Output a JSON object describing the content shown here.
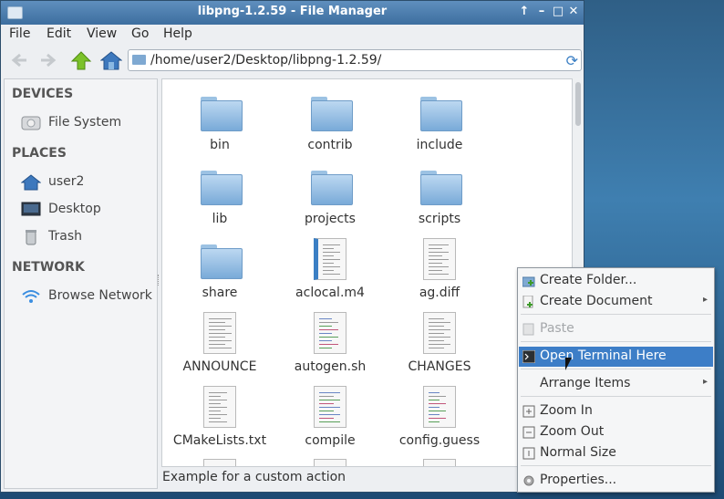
{
  "window": {
    "title": "libpng-1.2.59 - File Manager",
    "controls": {
      "up": "↑",
      "minimize": "–",
      "maximize": "□",
      "close": "✕"
    }
  },
  "menubar": {
    "items": [
      "File",
      "Edit",
      "View",
      "Go",
      "Help"
    ]
  },
  "toolbar": {
    "path": "/home/user2/Desktop/libpng-1.2.59/",
    "icons": [
      "back-arrow-icon",
      "forward-arrow-icon",
      "up-arrow-icon",
      "home-icon",
      "reload-icon"
    ]
  },
  "sidebar": {
    "sections": [
      {
        "heading": "DEVICES",
        "items": [
          {
            "label": "File System",
            "icon": "drive-icon"
          }
        ]
      },
      {
        "heading": "PLACES",
        "items": [
          {
            "label": "user2",
            "icon": "home-icon"
          },
          {
            "label": "Desktop",
            "icon": "desktop-icon"
          },
          {
            "label": "Trash",
            "icon": "trash-icon"
          }
        ]
      },
      {
        "heading": "NETWORK",
        "items": [
          {
            "label": "Browse Network",
            "icon": "wifi-icon"
          }
        ]
      }
    ]
  },
  "files": [
    {
      "name": "bin",
      "type": "folder"
    },
    {
      "name": "contrib",
      "type": "folder"
    },
    {
      "name": "include",
      "type": "folder"
    },
    {
      "name": "lib",
      "type": "folder"
    },
    {
      "name": "projects",
      "type": "folder"
    },
    {
      "name": "scripts",
      "type": "folder"
    },
    {
      "name": "share",
      "type": "folder"
    },
    {
      "name": "aclocal.m4",
      "type": "m4"
    },
    {
      "name": "ag.diff",
      "type": "text"
    },
    {
      "name": "ANNOUNCE",
      "type": "text"
    },
    {
      "name": "autogen.sh",
      "type": "script"
    },
    {
      "name": "CHANGES",
      "type": "text"
    },
    {
      "name": "CMakeLists.txt",
      "type": "text"
    },
    {
      "name": "compile",
      "type": "script"
    },
    {
      "name": "config.guess",
      "type": "script"
    }
  ],
  "status": {
    "text": "Example for a custom action"
  },
  "context_menu": {
    "items": [
      {
        "label": "Create Folder...",
        "icon": "new-folder-icon",
        "submenu": false,
        "state": "normal"
      },
      {
        "label": "Create Document",
        "icon": "new-document-icon",
        "submenu": true,
        "state": "normal"
      },
      {
        "label": "Paste",
        "icon": "paste-icon",
        "submenu": false,
        "state": "disabled"
      },
      {
        "label": "Open Terminal Here",
        "icon": "terminal-icon",
        "submenu": false,
        "state": "highlighted"
      },
      {
        "label": "Arrange Items",
        "icon": "",
        "submenu": true,
        "state": "normal"
      },
      {
        "label": "Zoom In",
        "icon": "zoom-in-icon",
        "submenu": false,
        "state": "normal"
      },
      {
        "label": "Zoom Out",
        "icon": "zoom-out-icon",
        "submenu": false,
        "state": "normal"
      },
      {
        "label": "Normal Size",
        "icon": "normal-size-icon",
        "submenu": false,
        "state": "normal"
      },
      {
        "label": "Properties...",
        "icon": "gear-icon",
        "submenu": false,
        "state": "normal"
      }
    ],
    "submenu_arrow": "▸"
  },
  "colors": {
    "accent": "#3d7ec7",
    "titlebar": "#4a7aab",
    "folder": "#8ab8e2"
  }
}
